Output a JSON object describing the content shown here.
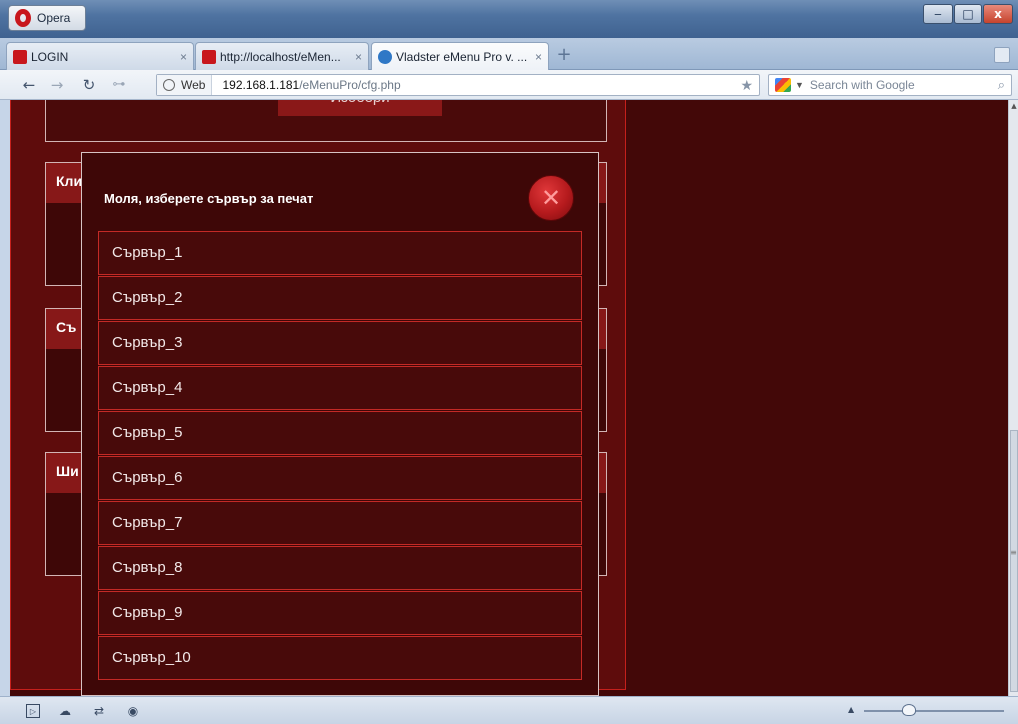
{
  "window": {
    "app_button_label": "Opera",
    "controls": {
      "minimize": "‒",
      "maximize": "□",
      "close": "x"
    }
  },
  "tabs": [
    {
      "title": "LOGIN",
      "icon": "opera-icon",
      "active": false
    },
    {
      "title": "http://localhost/eMen...",
      "icon": "opera-icon",
      "active": false
    },
    {
      "title": "Vladster eMenu Pro v. ...",
      "icon": "ie-icon",
      "active": true
    }
  ],
  "tab_close_glyph": "×",
  "new_tab_glyph": "+",
  "address": {
    "badge": "Web",
    "host": "192.168.1.181",
    "path": "/eMenuPro/cfg.php"
  },
  "search": {
    "placeholder": "Search with Google"
  },
  "page": {
    "search_button_label": "Изобери",
    "sections": [
      {
        "label": "Кли"
      },
      {
        "label": "Съ"
      },
      {
        "label": "Ши"
      }
    ]
  },
  "modal": {
    "title": "Моля, изберете сървър за печат",
    "close_glyph": "✕",
    "servers": [
      "Сървър_1",
      "Сървър_2",
      "Сървър_3",
      "Сървър_4",
      "Сървър_5",
      "Сървър_6",
      "Сървър_7",
      "Сървър_8",
      "Сървър_9",
      "Сървър_10"
    ]
  },
  "colors": {
    "page_background": "#430808",
    "panel": "#5e0c0c",
    "accent_red": "#c42a26",
    "modal_background": "#3e0707"
  }
}
